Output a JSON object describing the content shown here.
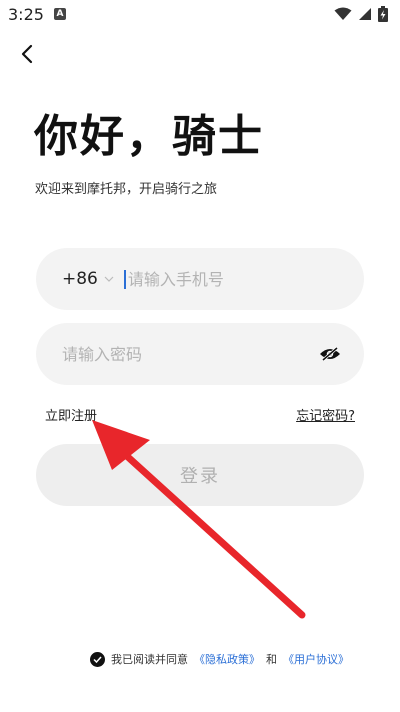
{
  "status_bar": {
    "time": "3:25",
    "notification_icon": "A",
    "icons": [
      "wifi-icon",
      "signal-icon",
      "battery-charging-icon"
    ]
  },
  "header": {
    "back_icon": "chevron-left-icon"
  },
  "title": "你好，骑士",
  "subtitle": "欢迎来到摩托邦，开启骑行之旅",
  "phone": {
    "country_code": "+86",
    "placeholder": "请输入手机号",
    "value": ""
  },
  "password": {
    "placeholder": "请输入密码",
    "value": "",
    "toggle_icon": "eye-off-icon"
  },
  "links": {
    "register": "立即注册",
    "forgot": "忘记密码?"
  },
  "login_label": "登录",
  "agreement": {
    "checked": true,
    "prefix": "我已阅读并同意",
    "privacy": "《隐私政策》",
    "and": "和",
    "terms": "《用户协议》"
  },
  "colors": {
    "link_blue": "#2b6fd6",
    "annotation_red": "#e8262b",
    "field_bg": "#f3f3f3",
    "button_bg": "#eeeeee"
  }
}
